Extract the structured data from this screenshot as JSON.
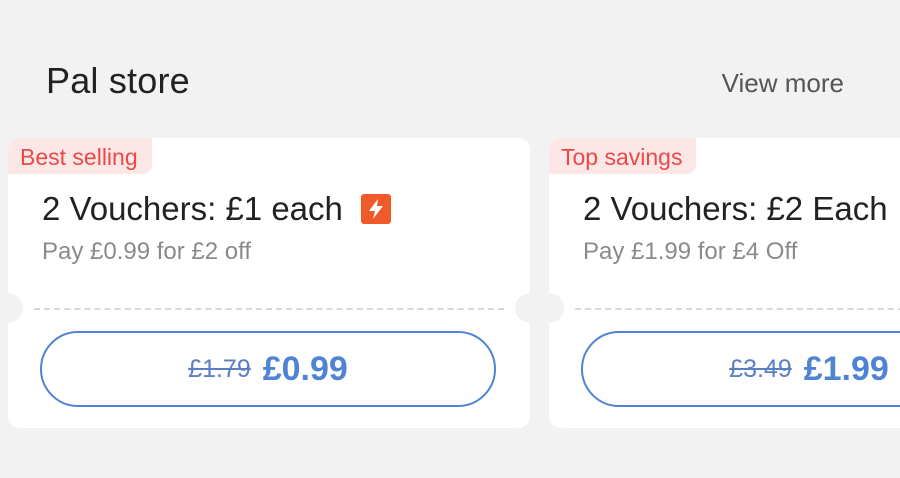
{
  "section": {
    "title": "Pal store",
    "view_more": "View more"
  },
  "cards": [
    {
      "badge": "Best selling",
      "title": "2 Vouchers: £1 each",
      "has_flash_icon": true,
      "subtitle": "Pay £0.99 for £2 off",
      "old_price": "£1.79",
      "new_price": "£0.99"
    },
    {
      "badge": "Top savings",
      "title": "2 Vouchers: £2 Each",
      "subtitle": "Pay £1.99 for £4 Off",
      "old_price": "£3.49",
      "new_price": "£1.99"
    }
  ],
  "colors": {
    "background": "#f2f2f2",
    "badge_bg": "#fde6e6",
    "badge_text": "#e84a4a",
    "accent": "#4f84d4",
    "flash_icon": "#f05a28"
  },
  "icons": {
    "flash": "lightning-bolt-icon"
  }
}
